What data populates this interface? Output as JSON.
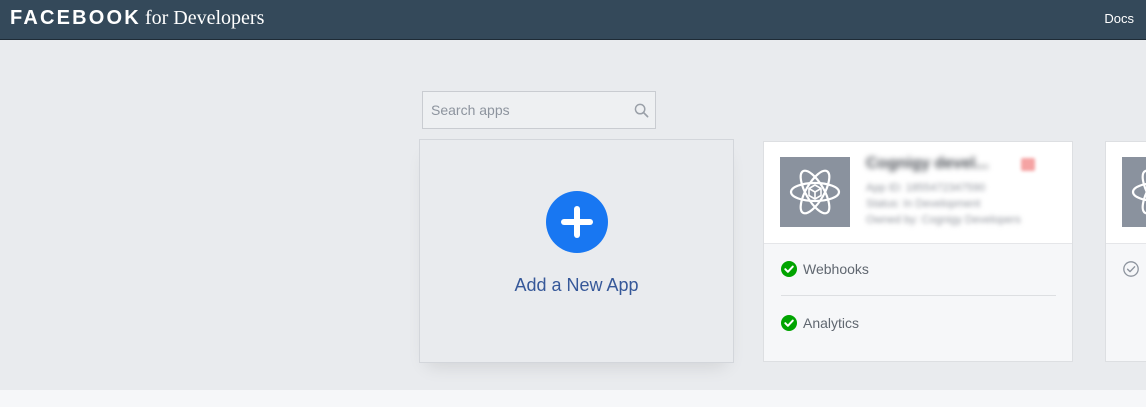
{
  "header": {
    "brand_name": "FACEBOOK",
    "brand_suffix": "for Developers",
    "docs_label": "Docs",
    "background_color": "#34495a"
  },
  "search": {
    "placeholder": "Search apps",
    "value": "",
    "icon": "search-icon"
  },
  "add_app": {
    "label": "Add a New App",
    "icon": "plus-circle-icon",
    "accent_color": "#1877f2"
  },
  "apps": [
    {
      "name": "Cognigy devel...",
      "meta": [
        "App ID: 1855472347590",
        "Status: In Development",
        "Owned by: Cognigy Developers"
      ],
      "icon": "atom-icon",
      "products": [
        {
          "label": "Webhooks",
          "status": "active"
        },
        {
          "label": "Analytics",
          "status": "active"
        }
      ]
    },
    {
      "icon": "atom-icon",
      "products": [
        {
          "status": "inactive"
        }
      ]
    }
  ],
  "colors": {
    "active_check": "#00a400",
    "link_text": "#365899"
  }
}
